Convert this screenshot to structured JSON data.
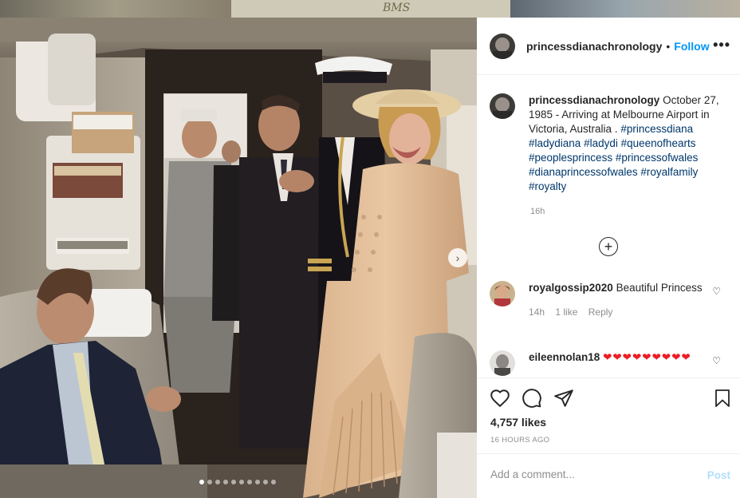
{
  "background": {
    "brand_text": "BMS"
  },
  "photo": {
    "next_icon": "chevron-right-icon",
    "carousel": {
      "total": 10,
      "active_index": 0
    }
  },
  "header": {
    "username": "princessdianachronology",
    "separator": "•",
    "follow_label": "Follow",
    "more_icon": "•••"
  },
  "caption": {
    "username": "princessdianachronology",
    "text": "October 27, 1985 - Arriving at Melbourne Airport in Victoria, Australia .",
    "hashtags": [
      "#princessdiana",
      "#ladydiana",
      "#ladydi",
      "#queenofhearts",
      "#peoplesprincess",
      "#princessofwales",
      "#dianaprincessofwales",
      "#royalfamily",
      "#royalty"
    ],
    "time": "16h"
  },
  "load_more_icon": "plus-circle-icon",
  "comments": [
    {
      "username": "royalgossip2020",
      "text": "Beautiful Princess",
      "time": "14h",
      "likes": "1 like",
      "reply": "Reply"
    },
    {
      "username": "eileennolan18",
      "text": "❤❤❤❤❤❤❤❤❤"
    }
  ],
  "actions": {
    "likes": "4,757 likes",
    "post_time": "16 HOURS AGO"
  },
  "add_comment": {
    "placeholder": "Add a comment...",
    "post_label": "Post"
  },
  "colors": {
    "accent": "#0095f6",
    "hashtag": "#00376b",
    "muted": "#8e8e8e",
    "post_disabled": "#b2dffc"
  }
}
